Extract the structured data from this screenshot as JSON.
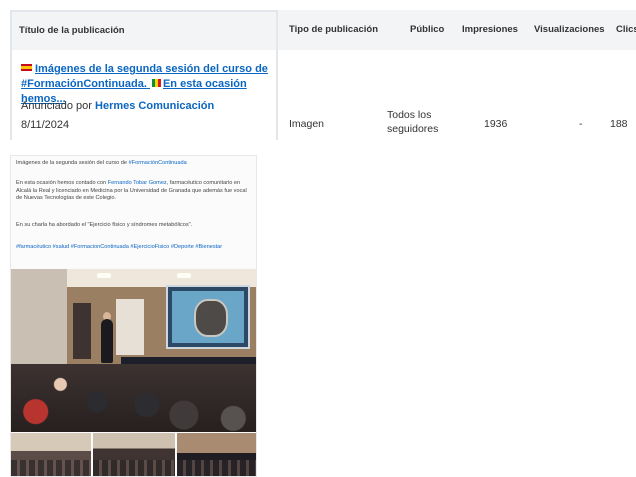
{
  "table": {
    "headers": {
      "title": "Título de la publicación",
      "type": "Tipo de publicación",
      "audience": "Público",
      "impressions": "Impresiones",
      "views": "Visualizaciones",
      "clicks": "Clics"
    },
    "row": {
      "title_part1": "Imágenes de la segunda sesión del curso de #FormaciónContinuada.",
      "title_part2": "En esta ocasión hemos...",
      "announced_prefix": "Anunciado por",
      "announcer": "Hermes Comunicación",
      "date": "8/11/2024",
      "type": "Imagen",
      "audience": "Todos los seguidores",
      "impressions": "1936",
      "views": "-",
      "clicks": "188"
    }
  },
  "post": {
    "line1_prefix": "Imágenes de la segunda sesión del curso de",
    "line1_tag": "#FormaciónContinuada",
    "line2_prefix": "En esta ocasión hemos contado con",
    "line2_person": "Fernando Tobar Gomez",
    "line2_rest": ", farmacéutico comunitario en Alcalá la Real y licenciado en Medicina por la Universidad de Granada que además fue vocal de Nuevas Tecnologías de este Colegio.",
    "line3": "En su charla ha abordado el \"Ejercicio físico y síndromes metabólicos\".",
    "hashtags": "#farmacéutico #salud #FormacionContinuada #EjercicioFisico #Deporte #Bienestar"
  }
}
